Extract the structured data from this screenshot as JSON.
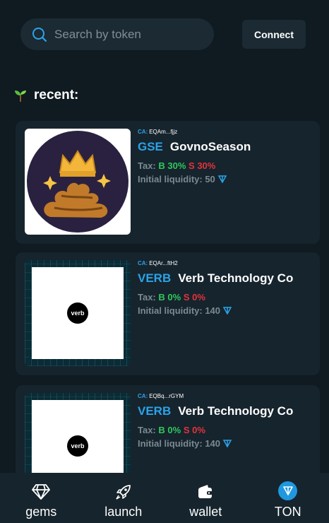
{
  "search": {
    "placeholder": "Search by token"
  },
  "header": {
    "connect_label": "Connect"
  },
  "section": {
    "recent_label": "recent:"
  },
  "tokens": [
    {
      "ca_label": "CA:",
      "ca": "EQAm...fjjz",
      "ticker": "GSE",
      "name": "GovnoSeason",
      "tax_label": "Tax:",
      "buy": "B 30%",
      "sell": "S 30%",
      "liquidity_label": "Initial liquidity: 50"
    },
    {
      "ca_label": "CA:",
      "ca": "EQAr...ftH2",
      "ticker": "VERB",
      "name": "Verb Technology Co",
      "tax_label": "Tax:",
      "buy": "B 0%",
      "sell": "S 0%",
      "liquidity_label": "Initial liquidity: 140",
      "logo_text": "verb"
    },
    {
      "ca_label": "CA:",
      "ca": "EQBq...rGYM",
      "ticker": "VERB",
      "name": "Verb Technology Co",
      "tax_label": "Tax:",
      "buy": "B 0%",
      "sell": "S 0%",
      "liquidity_label": "Initial liquidity: 140",
      "logo_text": "verb"
    }
  ],
  "nav": [
    {
      "label": "gems",
      "icon": "diamond-icon"
    },
    {
      "label": "launch",
      "icon": "rocket-icon"
    },
    {
      "label": "wallet",
      "icon": "wallet-icon"
    },
    {
      "label": "TON",
      "icon": "ton-icon"
    }
  ],
  "colors": {
    "accent": "#2ba3e8",
    "buy": "#2fc85c",
    "sell": "#e4323c",
    "background": "#0f1a21",
    "card": "#16242d"
  }
}
